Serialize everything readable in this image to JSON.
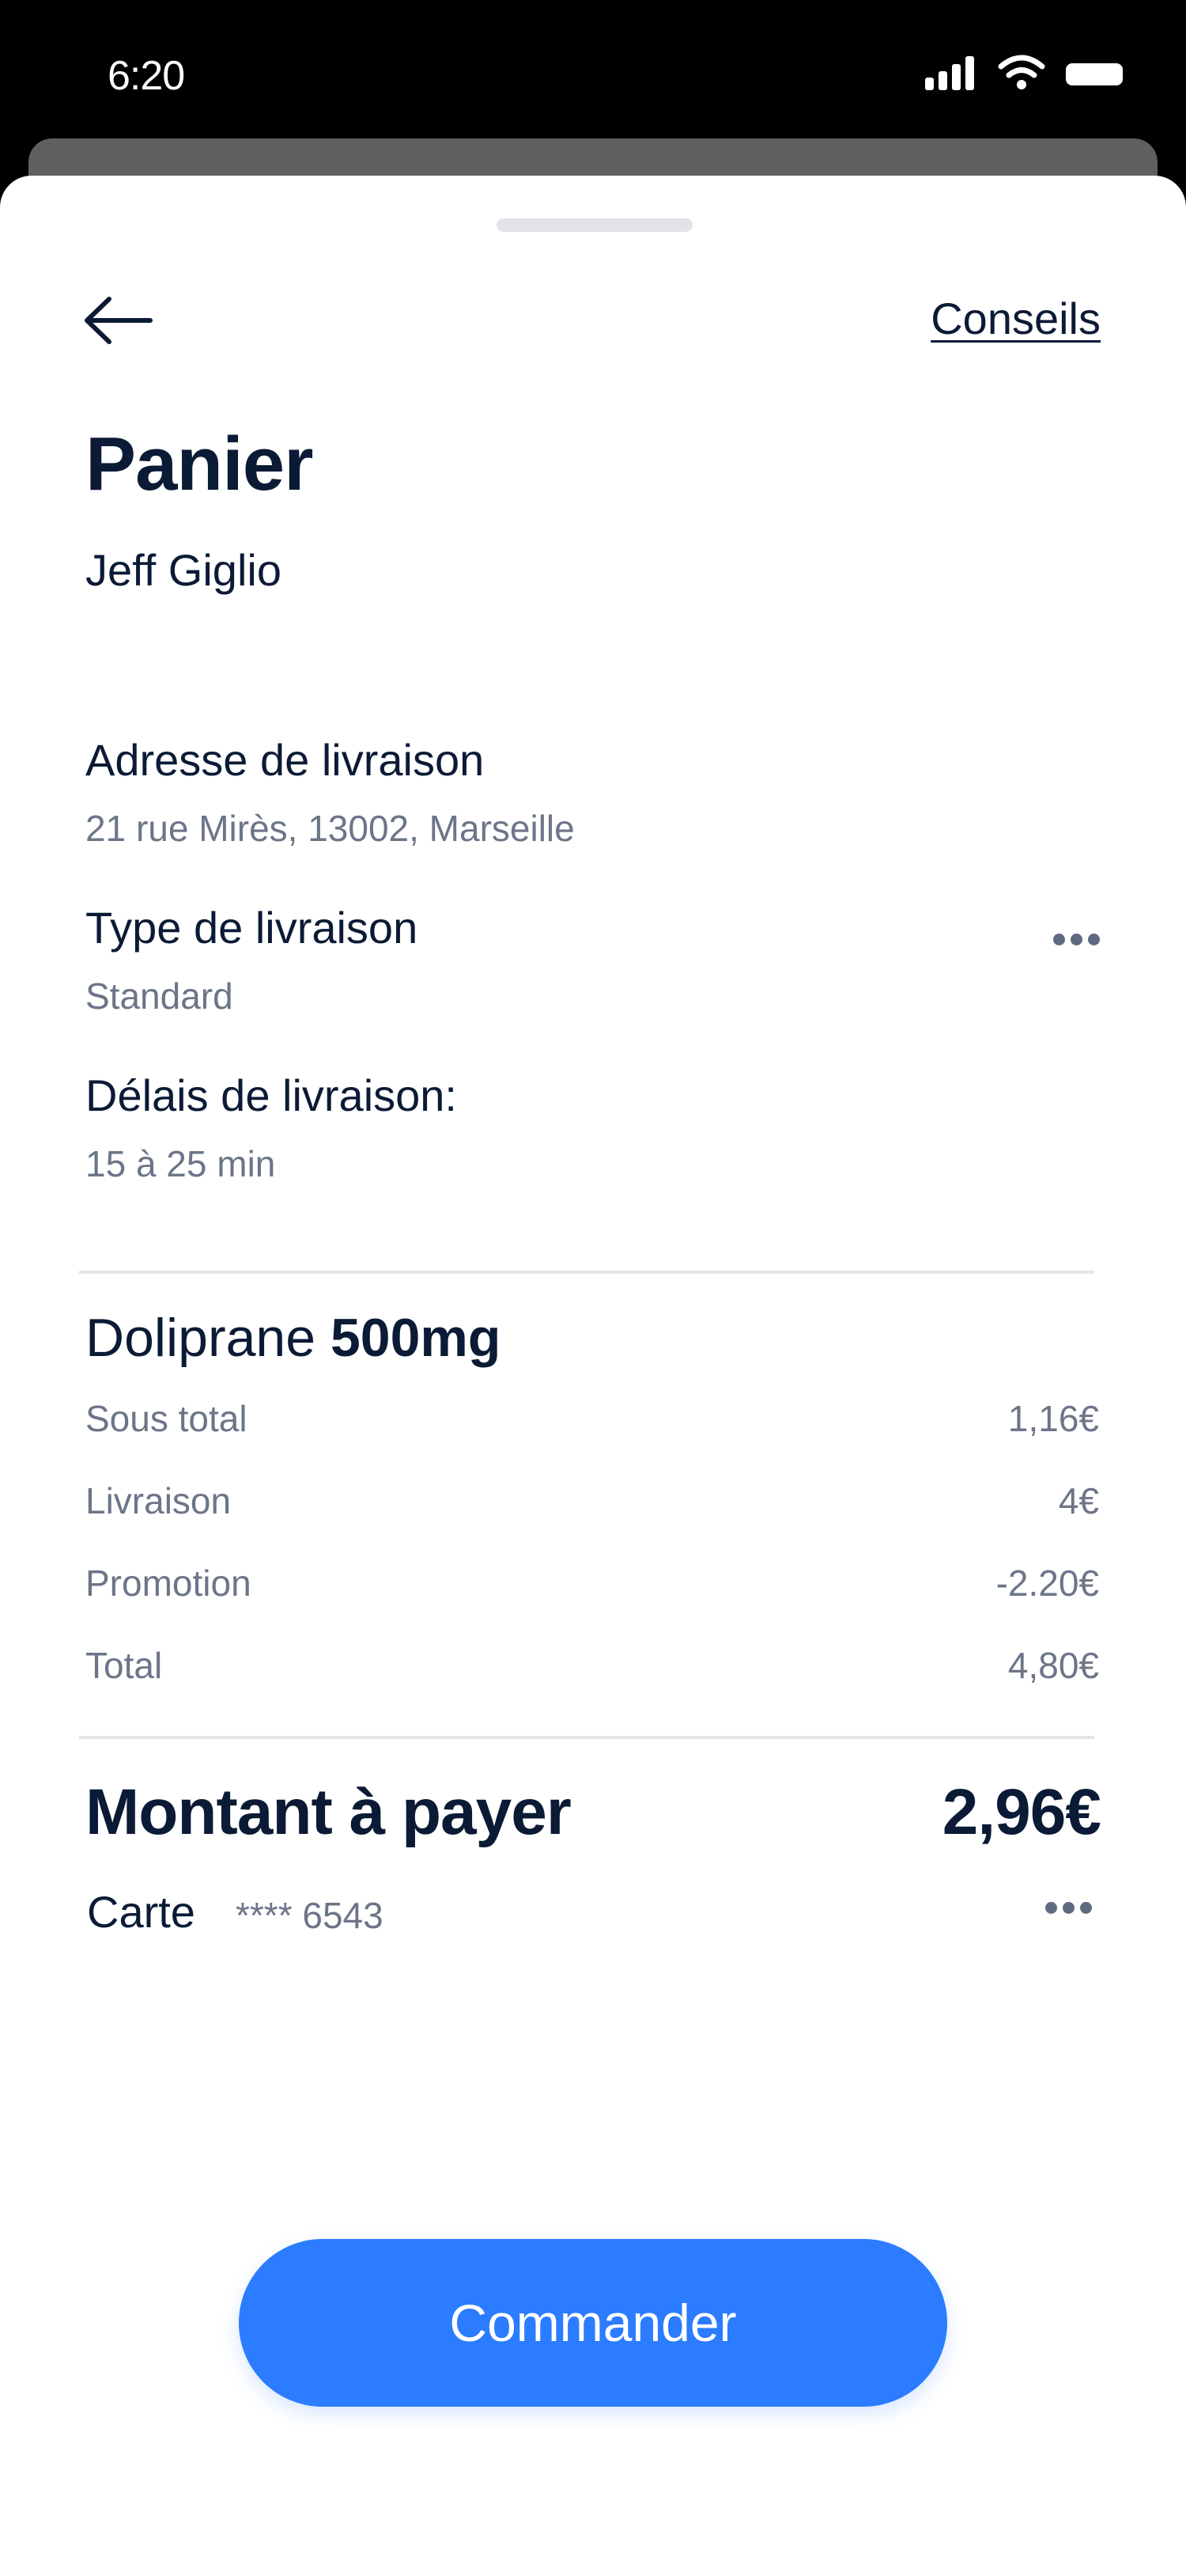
{
  "status_bar": {
    "time": "6:20"
  },
  "header": {
    "back_icon": "arrow-left-icon",
    "tips_link": "Conseils"
  },
  "page": {
    "title": "Panier",
    "customer_name": "Jeff Giglio"
  },
  "delivery": {
    "address_label": "Adresse de livraison",
    "address_value": "21 rue Mirès, 13002, Marseille",
    "type_label": "Type de livraison",
    "type_value": "Standard",
    "delay_label": "Délais de livraison:",
    "delay_value": "15 à 25 min"
  },
  "product": {
    "name": "Doliprane",
    "dose": "500mg"
  },
  "summary": {
    "lines": [
      {
        "label": "Sous total",
        "value": "1,16€"
      },
      {
        "label": "Livraison",
        "value": "4€"
      },
      {
        "label": "Promotion",
        "value": "-2.20€"
      },
      {
        "label": "Total",
        "value": "4,80€"
      }
    ]
  },
  "payment": {
    "amount_label": "Montant à payer",
    "amount_value": "2,96€",
    "method_label": "Carte",
    "card_number": "**** 6543"
  },
  "actions": {
    "order_button": "Commander"
  },
  "colors": {
    "primary": "#2b7cff",
    "text_dark": "#0b1a35",
    "text_muted": "#6c7588"
  }
}
